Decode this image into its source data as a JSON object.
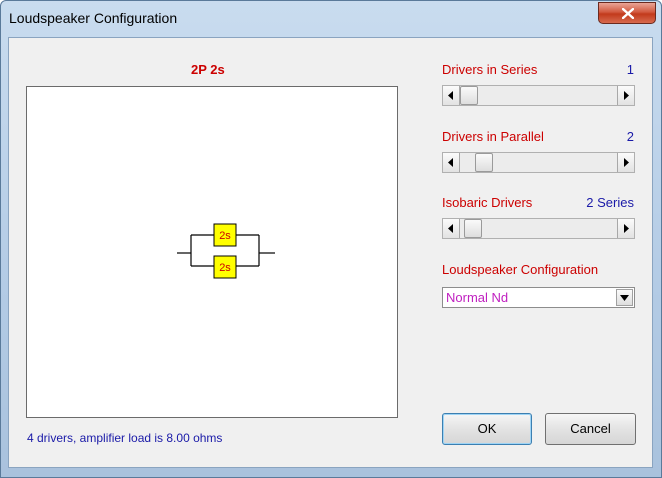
{
  "window": {
    "title": "Loudspeaker Configuration"
  },
  "diagram": {
    "configuration_label": "2P 2s",
    "drivers": [
      {
        "label": "2s"
      },
      {
        "label": "2s"
      }
    ]
  },
  "status": {
    "text": "4 drivers, amplifier load is 8.00 ohms"
  },
  "controls": {
    "series": {
      "label": "Drivers in Series",
      "value": "1",
      "slider_fraction": 0.0
    },
    "parallel": {
      "label": "Drivers in Parallel",
      "value": "2",
      "slider_fraction": 0.11
    },
    "isobaric": {
      "label": "Isobaric Drivers",
      "value": "2 Series",
      "slider_fraction": 0.03
    },
    "configuration": {
      "label": "Loudspeaker Configuration",
      "selected": "Normal Nd"
    }
  },
  "buttons": {
    "ok": "OK",
    "cancel": "Cancel"
  },
  "colors": {
    "label_red": "#cc0000",
    "value_blue": "#1a1aa8",
    "driver_fill": "#ffff00",
    "combo_text": "#c020c0"
  },
  "icons": {
    "close": "close-icon",
    "left_arrow": "arrow-left-icon",
    "right_arrow": "arrow-right-icon",
    "dropdown": "chevron-down-icon"
  }
}
